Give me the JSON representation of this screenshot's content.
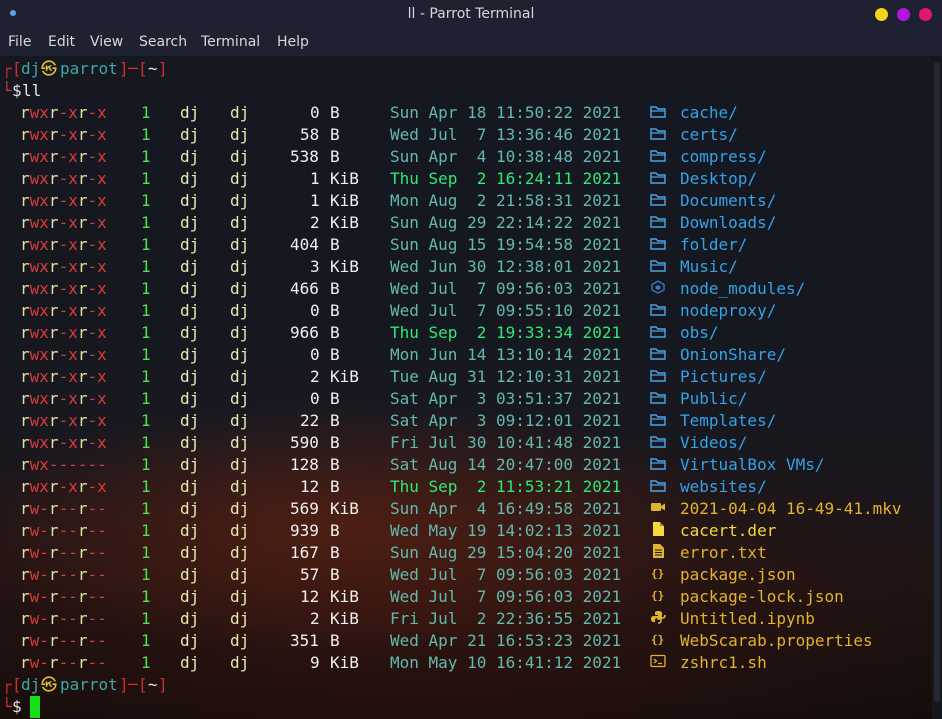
{
  "window": {
    "title": "ll - Parrot Terminal",
    "controls": [
      "#f4d21f",
      "#b316e0",
      "#e0186a"
    ]
  },
  "menu": [
    "File",
    "Edit",
    "View",
    "Search",
    "Terminal",
    "Help"
  ],
  "prompt": {
    "corner_top": "┌",
    "corner_bottom": "└",
    "bracket_open": "[",
    "bracket_close": "]",
    "dash": "─",
    "user": "dj",
    "symbol": "㉿",
    "host": "parrot",
    "dir": "~",
    "dollar": "$",
    "command": "ll"
  },
  "colors": {
    "perm_r": "#e0e0a0",
    "perm_w": "#d63a3a",
    "perm_x": "#e03a3a",
    "perm_dash": "#cc4040",
    "links": "#4ce34c",
    "owner": "#e8e8b0",
    "size": "#f0f0f0",
    "unit": "#f0f0f0",
    "date": "#63b8ad",
    "date_recent": "#2ee878",
    "dir": "#31a3e8",
    "file": "#e2b32c",
    "file_bright": "#f5d83b",
    "dir_icon": "#4aa6e8",
    "node_icon": "#3a78c8"
  },
  "listing": [
    {
      "perms": "rwxr-xr-x",
      "links": "1",
      "owner": "dj",
      "group": "dj",
      "size": "0",
      "unit": "B",
      "date": "Sun Apr 18 11:50:22 2021",
      "recent": false,
      "icon": "folder-icon",
      "name": "cache/",
      "kind": "dir"
    },
    {
      "perms": "rwxr-xr-x",
      "links": "1",
      "owner": "dj",
      "group": "dj",
      "size": "58",
      "unit": "B",
      "date": "Wed Jul  7 13:36:46 2021",
      "recent": false,
      "icon": "folder-icon",
      "name": "certs/",
      "kind": "dir"
    },
    {
      "perms": "rwxr-xr-x",
      "links": "1",
      "owner": "dj",
      "group": "dj",
      "size": "538",
      "unit": "B",
      "date": "Sun Apr  4 10:38:48 2021",
      "recent": false,
      "icon": "folder-icon",
      "name": "compress/",
      "kind": "dir"
    },
    {
      "perms": "rwxr-xr-x",
      "links": "1",
      "owner": "dj",
      "group": "dj",
      "size": "1",
      "unit": "KiB",
      "date": "Thu Sep  2 16:24:11 2021",
      "recent": true,
      "icon": "folder-icon",
      "name": "Desktop/",
      "kind": "dir"
    },
    {
      "perms": "rwxr-xr-x",
      "links": "1",
      "owner": "dj",
      "group": "dj",
      "size": "1",
      "unit": "KiB",
      "date": "Mon Aug  2 21:58:31 2021",
      "recent": false,
      "icon": "folder-icon",
      "name": "Documents/",
      "kind": "dir"
    },
    {
      "perms": "rwxr-xr-x",
      "links": "1",
      "owner": "dj",
      "group": "dj",
      "size": "2",
      "unit": "KiB",
      "date": "Sun Aug 29 22:14:22 2021",
      "recent": false,
      "icon": "folder-icon",
      "name": "Downloads/",
      "kind": "dir"
    },
    {
      "perms": "rwxr-xr-x",
      "links": "1",
      "owner": "dj",
      "group": "dj",
      "size": "404",
      "unit": "B",
      "date": "Sun Aug 15 19:54:58 2021",
      "recent": false,
      "icon": "folder-icon",
      "name": "folder/",
      "kind": "dir"
    },
    {
      "perms": "rwxr-xr-x",
      "links": "1",
      "owner": "dj",
      "group": "dj",
      "size": "3",
      "unit": "KiB",
      "date": "Wed Jun 30 12:38:01 2021",
      "recent": false,
      "icon": "folder-icon",
      "name": "Music/",
      "kind": "dir"
    },
    {
      "perms": "rwxr-xr-x",
      "links": "1",
      "owner": "dj",
      "group": "dj",
      "size": "466",
      "unit": "B",
      "date": "Wed Jul  7 09:56:03 2021",
      "recent": false,
      "icon": "nodejs-icon",
      "name": "node_modules/",
      "kind": "dir"
    },
    {
      "perms": "rwxr-xr-x",
      "links": "1",
      "owner": "dj",
      "group": "dj",
      "size": "0",
      "unit": "B",
      "date": "Wed Jul  7 09:55:10 2021",
      "recent": false,
      "icon": "folder-icon",
      "name": "nodeproxy/",
      "kind": "dir"
    },
    {
      "perms": "rwxr-xr-x",
      "links": "1",
      "owner": "dj",
      "group": "dj",
      "size": "966",
      "unit": "B",
      "date": "Thu Sep  2 19:33:34 2021",
      "recent": true,
      "icon": "folder-icon",
      "name": "obs/",
      "kind": "dir"
    },
    {
      "perms": "rwxr-xr-x",
      "links": "1",
      "owner": "dj",
      "group": "dj",
      "size": "0",
      "unit": "B",
      "date": "Mon Jun 14 13:10:14 2021",
      "recent": false,
      "icon": "folder-icon",
      "name": "OnionShare/",
      "kind": "dir"
    },
    {
      "perms": "rwxr-xr-x",
      "links": "1",
      "owner": "dj",
      "group": "dj",
      "size": "2",
      "unit": "KiB",
      "date": "Tue Aug 31 12:10:31 2021",
      "recent": false,
      "icon": "folder-icon",
      "name": "Pictures/",
      "kind": "dir"
    },
    {
      "perms": "rwxr-xr-x",
      "links": "1",
      "owner": "dj",
      "group": "dj",
      "size": "0",
      "unit": "B",
      "date": "Sat Apr  3 03:51:37 2021",
      "recent": false,
      "icon": "folder-icon",
      "name": "Public/",
      "kind": "dir"
    },
    {
      "perms": "rwxr-xr-x",
      "links": "1",
      "owner": "dj",
      "group": "dj",
      "size": "22",
      "unit": "B",
      "date": "Sat Apr  3 09:12:01 2021",
      "recent": false,
      "icon": "folder-icon",
      "name": "Templates/",
      "kind": "dir"
    },
    {
      "perms": "rwxr-xr-x",
      "links": "1",
      "owner": "dj",
      "group": "dj",
      "size": "590",
      "unit": "B",
      "date": "Fri Jul 30 10:41:48 2021",
      "recent": false,
      "icon": "folder-icon",
      "name": "Videos/",
      "kind": "dir"
    },
    {
      "perms": "rwx------",
      "links": "1",
      "owner": "dj",
      "group": "dj",
      "size": "128",
      "unit": "B",
      "date": "Sat Aug 14 20:47:00 2021",
      "recent": false,
      "icon": "folder-icon",
      "name": "VirtualBox VMs/",
      "kind": "dir"
    },
    {
      "perms": "rwxr-xr-x",
      "links": "1",
      "owner": "dj",
      "group": "dj",
      "size": "12",
      "unit": "B",
      "date": "Thu Sep  2 11:53:21 2021",
      "recent": true,
      "icon": "folder-icon",
      "name": "websites/",
      "kind": "dir"
    },
    {
      "perms": "rw-r--r--",
      "links": "1",
      "owner": "dj",
      "group": "dj",
      "size": "569",
      "unit": "KiB",
      "date": "Sun Apr  4 16:49:58 2021",
      "recent": false,
      "icon": "video-icon",
      "name": "2021-04-04 16-49-41.mkv",
      "kind": "file"
    },
    {
      "perms": "rw-r--r--",
      "links": "1",
      "owner": "dj",
      "group": "dj",
      "size": "939",
      "unit": "B",
      "date": "Wed May 19 14:02:13 2021",
      "recent": false,
      "icon": "file-icon",
      "name": "cacert.der",
      "kind": "file-bright"
    },
    {
      "perms": "rw-r--r--",
      "links": "1",
      "owner": "dj",
      "group": "dj",
      "size": "167",
      "unit": "B",
      "date": "Sun Aug 29 15:04:20 2021",
      "recent": false,
      "icon": "text-file-icon",
      "name": "error.txt",
      "kind": "file"
    },
    {
      "perms": "rw-r--r--",
      "links": "1",
      "owner": "dj",
      "group": "dj",
      "size": "57",
      "unit": "B",
      "date": "Wed Jul  7 09:56:03 2021",
      "recent": false,
      "icon": "json-icon",
      "name": "package.json",
      "kind": "file"
    },
    {
      "perms": "rw-r--r--",
      "links": "1",
      "owner": "dj",
      "group": "dj",
      "size": "12",
      "unit": "KiB",
      "date": "Wed Jul  7 09:56:03 2021",
      "recent": false,
      "icon": "json-icon",
      "name": "package-lock.json",
      "kind": "file"
    },
    {
      "perms": "rw-r--r--",
      "links": "1",
      "owner": "dj",
      "group": "dj",
      "size": "2",
      "unit": "KiB",
      "date": "Fri Jul  2 22:36:55 2021",
      "recent": false,
      "icon": "python-icon",
      "name": "Untitled.ipynb",
      "kind": "file"
    },
    {
      "perms": "rw-r--r--",
      "links": "1",
      "owner": "dj",
      "group": "dj",
      "size": "351",
      "unit": "B",
      "date": "Wed Apr 21 16:53:23 2021",
      "recent": false,
      "icon": "json-icon",
      "name": "WebScarab.properties",
      "kind": "file"
    },
    {
      "perms": "rw-r--r--",
      "links": "1",
      "owner": "dj",
      "group": "dj",
      "size": "9",
      "unit": "KiB",
      "date": "Mon May 10 16:41:12 2021",
      "recent": false,
      "icon": "terminal-icon",
      "name": "zshrc1.sh",
      "kind": "file"
    }
  ]
}
